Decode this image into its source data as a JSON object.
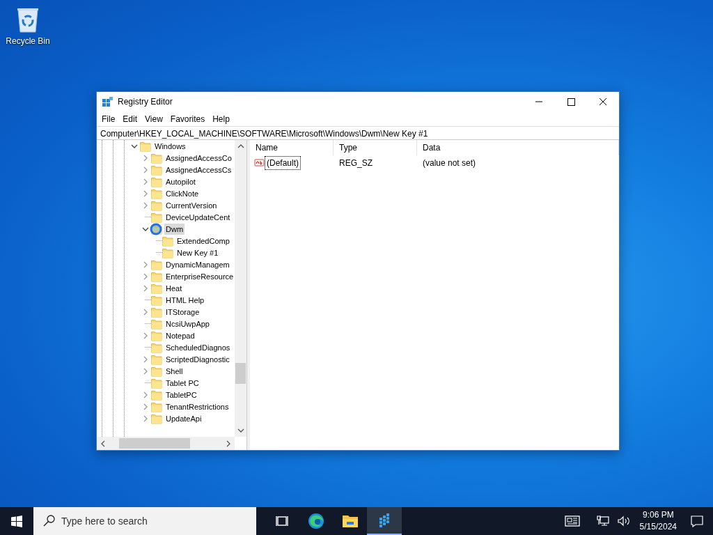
{
  "desktop_icons": [
    {
      "label": "Recycle Bin"
    }
  ],
  "window": {
    "title": "Registry Editor"
  },
  "menu": [
    {
      "label": "File"
    },
    {
      "label": "Edit"
    },
    {
      "label": "View"
    },
    {
      "label": "Favorites"
    },
    {
      "label": "Help"
    }
  ],
  "address": "Computer\\HKEY_LOCAL_MACHINE\\SOFTWARE\\Microsoft\\Windows\\Dwm\\New Key #1",
  "tree": [
    {
      "label": "Windows",
      "expanded": true,
      "selected": false,
      "children": [
        {
          "label": "AssignedAccessCo",
          "expanded": false,
          "selected": false
        },
        {
          "label": "AssignedAccessCs",
          "expanded": false,
          "selected": false
        },
        {
          "label": "Autopilot",
          "expanded": false,
          "selected": false
        },
        {
          "label": "ClickNote",
          "expanded": false,
          "selected": false
        },
        {
          "label": "CurrentVersion",
          "expanded": false,
          "selected": false
        },
        {
          "label": "DeviceUpdateCent",
          "selected": false
        },
        {
          "label": "Dwm",
          "expanded": true,
          "selected": true,
          "children": [
            {
              "label": "ExtendedComp",
              "selected": false
            },
            {
              "label": "New Key #1",
              "selected": false
            }
          ]
        },
        {
          "label": "DynamicManagem",
          "expanded": false,
          "selected": false
        },
        {
          "label": "EnterpriseResource",
          "expanded": false,
          "selected": false
        },
        {
          "label": "Heat",
          "expanded": false,
          "selected": false
        },
        {
          "label": "HTML Help",
          "selected": false
        },
        {
          "label": "ITStorage",
          "expanded": false,
          "selected": false
        },
        {
          "label": "NcsiUwpApp",
          "selected": false
        },
        {
          "label": "Notepad",
          "expanded": false,
          "selected": false
        },
        {
          "label": "ScheduledDiagnos",
          "selected": false
        },
        {
          "label": "ScriptedDiagnostic",
          "expanded": false,
          "selected": false
        },
        {
          "label": "Shell",
          "expanded": false,
          "selected": false
        },
        {
          "label": "Tablet PC",
          "selected": false
        },
        {
          "label": "TabletPC",
          "expanded": false,
          "selected": false
        },
        {
          "label": "TenantRestrictions",
          "expanded": false,
          "selected": false
        },
        {
          "label": "UpdateApi",
          "expanded": false,
          "selected": false
        }
      ]
    }
  ],
  "columns": [
    "Name",
    "Type",
    "Data"
  ],
  "values": [
    {
      "name": "(Default)",
      "type": "REG_SZ",
      "data": "(value not set)",
      "focused": true
    }
  ],
  "taskbar": {
    "search_placeholder": "Type here to search",
    "apps": [
      {
        "kind": "taskview",
        "active": false
      },
      {
        "kind": "edge",
        "active": false
      },
      {
        "kind": "explorer",
        "active": false
      },
      {
        "kind": "regedit",
        "active": true
      }
    ],
    "time": "9:06 PM",
    "date": "5/15/2024"
  }
}
